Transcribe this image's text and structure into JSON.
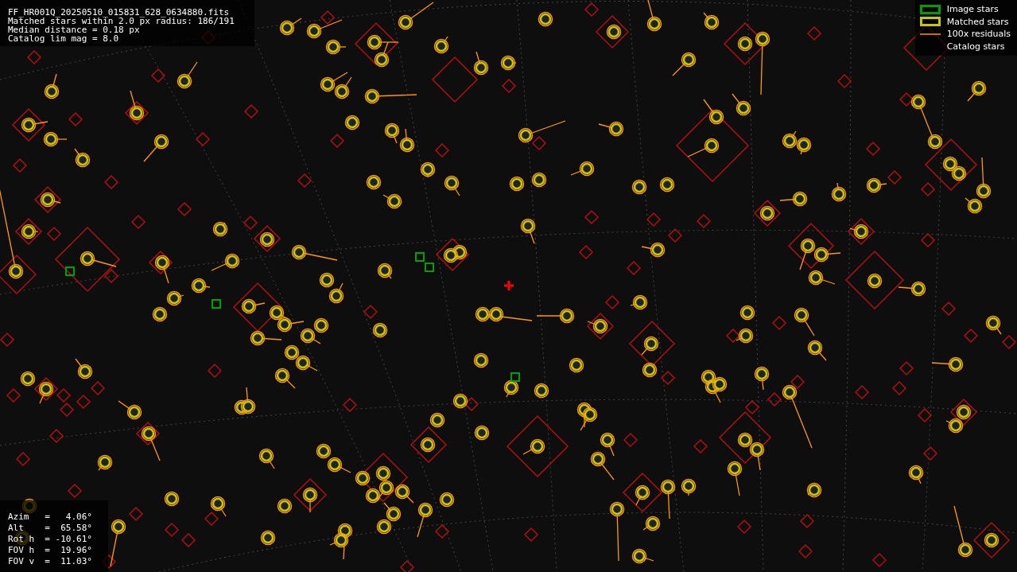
{
  "info": {
    "lines": [
      "FF_HR001Q_20250510_015831_628_0634880.fits",
      "Matched stars within 2.0 px radius: 186/191",
      "Median distance = 0.18 px",
      "Catalog lim mag = 8.0"
    ]
  },
  "legend": [
    {
      "kind": "image",
      "label": "Image stars"
    },
    {
      "kind": "matched",
      "label": "Matched stars"
    },
    {
      "kind": "residual",
      "label": "100x residuals"
    },
    {
      "kind": "catalog",
      "label": "Catalog stars"
    }
  ],
  "pointing": {
    "lines": [
      "Azim   =   4.06°",
      "Alt    =  65.58°",
      "Rot h  = -10.61°",
      "FOV h  =  19.96°",
      "FOV v  =  11.03°"
    ]
  }
}
